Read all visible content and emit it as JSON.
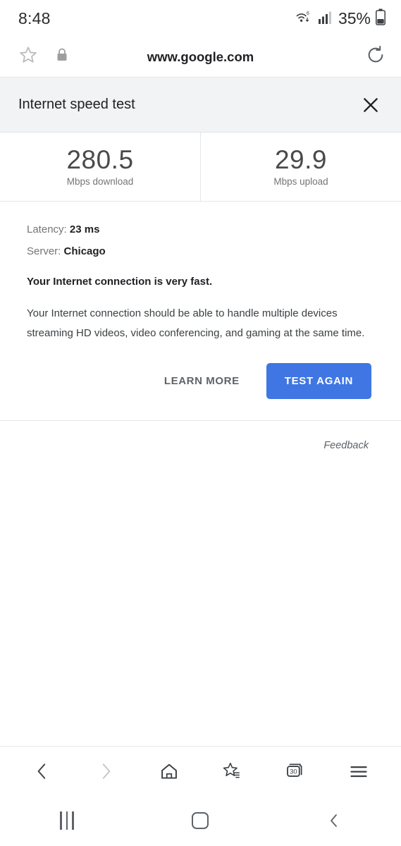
{
  "status_bar": {
    "time": "8:48",
    "battery_percent": "35%",
    "wifi_icon": "wifi-6-icon",
    "signal_icon": "cellular-signal-icon",
    "battery_icon": "battery-icon"
  },
  "url_bar": {
    "url": "www.google.com",
    "bookmark_icon": "star-outline-icon",
    "lock_icon": "lock-icon",
    "refresh_icon": "refresh-icon"
  },
  "speed_test": {
    "title": "Internet speed test",
    "close_icon": "close-icon",
    "results": [
      {
        "value": "280.5",
        "label": "Mbps download"
      },
      {
        "value": "29.9",
        "label": "Mbps upload"
      }
    ],
    "latency_label": "Latency:",
    "latency_value": "23 ms",
    "server_label": "Server:",
    "server_value": "Chicago",
    "verdict": "Your Internet connection is very fast.",
    "explanation": "Your Internet connection should be able to handle multiple devices streaming HD videos, video conferencing, and gaming at the same time.",
    "learn_more_label": "LEARN MORE",
    "test_again_label": "TEST AGAIN",
    "feedback_label": "Feedback",
    "accent_color": "#3f76e4",
    "header_background": "#f1f3f4"
  },
  "browser_toolbar": {
    "back_icon": "chevron-left-icon",
    "forward_icon": "chevron-right-icon",
    "home_icon": "home-icon",
    "bookmarks_icon": "bookmarks-star-icon",
    "tabs_icon": "tabs-icon",
    "tab_count": "30",
    "menu_icon": "hamburger-menu-icon"
  },
  "android_nav": {
    "recents_icon": "recents-icon",
    "home_icon": "home-circle-icon",
    "back_icon": "nav-back-icon"
  }
}
